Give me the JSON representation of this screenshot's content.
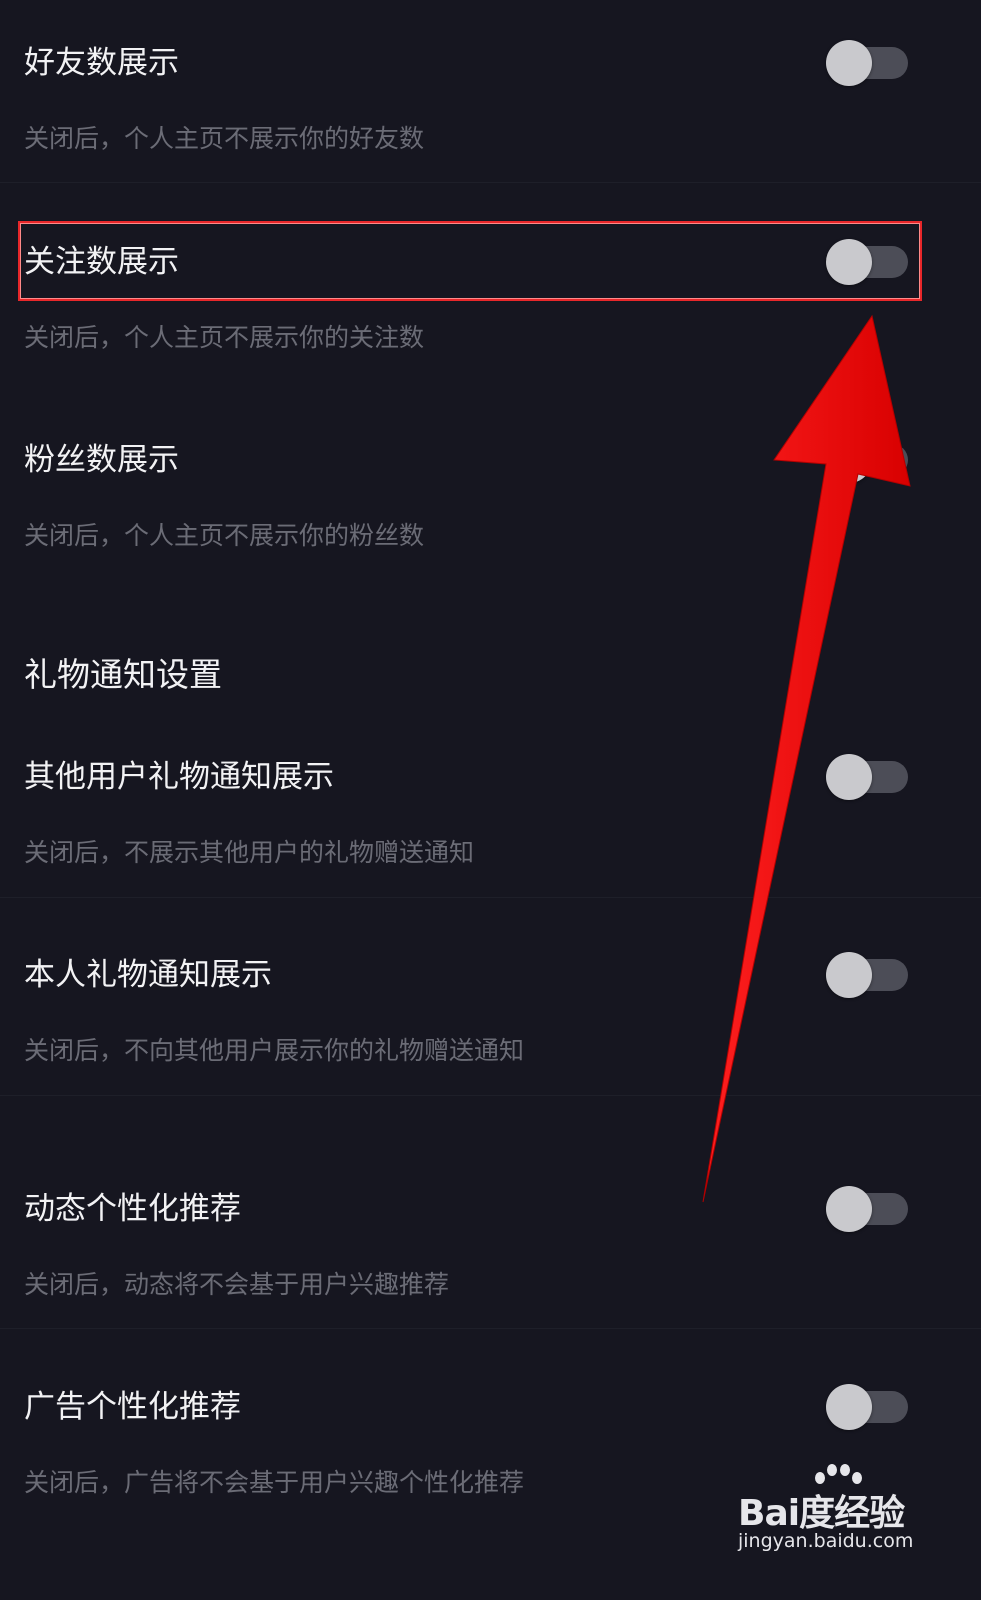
{
  "settings": [
    {
      "title": "好友数展示",
      "desc": "关闭后，个人主页不展示你的好友数",
      "enabled": false
    },
    {
      "title": "关注数展示",
      "desc": "关闭后，个人主页不展示你的关注数",
      "enabled": false
    },
    {
      "title": "粉丝数展示",
      "desc": "关闭后，个人主页不展示你的粉丝数",
      "enabled": false
    }
  ],
  "gift_section": {
    "title": "礼物通知设置",
    "items": [
      {
        "title": "其他用户礼物通知展示",
        "desc": "关闭后，不展示其他用户的礼物赠送通知",
        "enabled": false
      },
      {
        "title": "本人礼物通知展示",
        "desc": "关闭后，不向其他用户展示你的礼物赠送通知",
        "enabled": false
      }
    ]
  },
  "recommend": [
    {
      "title": "动态个性化推荐",
      "desc": "关闭后，动态将不会基于用户兴趣推荐",
      "enabled": false
    },
    {
      "title": "广告个性化推荐",
      "desc": "关闭后，广告将不会基于用户兴趣个性化推荐",
      "enabled": false
    }
  ],
  "watermark": {
    "logo": "Bai度经验",
    "url": "jingyan.baidu.com"
  },
  "colors": {
    "background": "#161620",
    "annotation": "#e8272a",
    "toggle_off_track": "#4c4d57",
    "toggle_knob": "#c9c9cd"
  }
}
